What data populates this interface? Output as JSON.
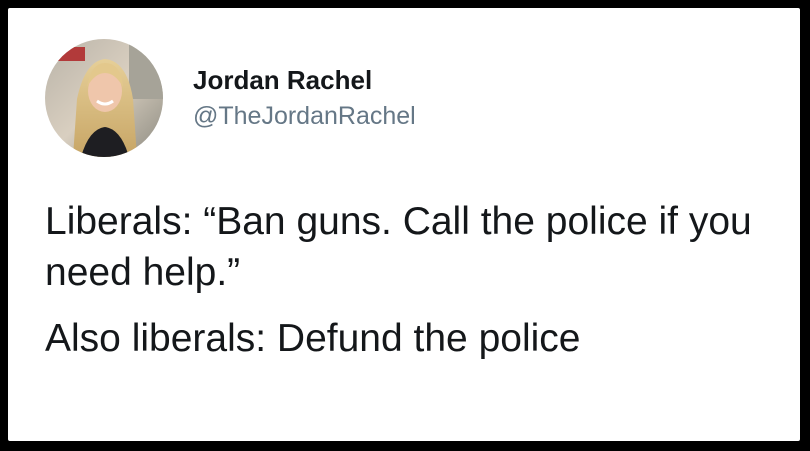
{
  "tweet": {
    "author": {
      "display_name": "Jordan Rachel",
      "handle": "@TheJordanRachel",
      "avatar_icon": "profile-photo"
    },
    "paragraphs": [
      "Liberals: “Ban guns. Call the police if you need help.”",
      "Also liberals: Defund the police"
    ]
  },
  "colors": {
    "text": "#14171a",
    "secondary_text": "#657786",
    "background": "#ffffff",
    "border": "#000000"
  }
}
